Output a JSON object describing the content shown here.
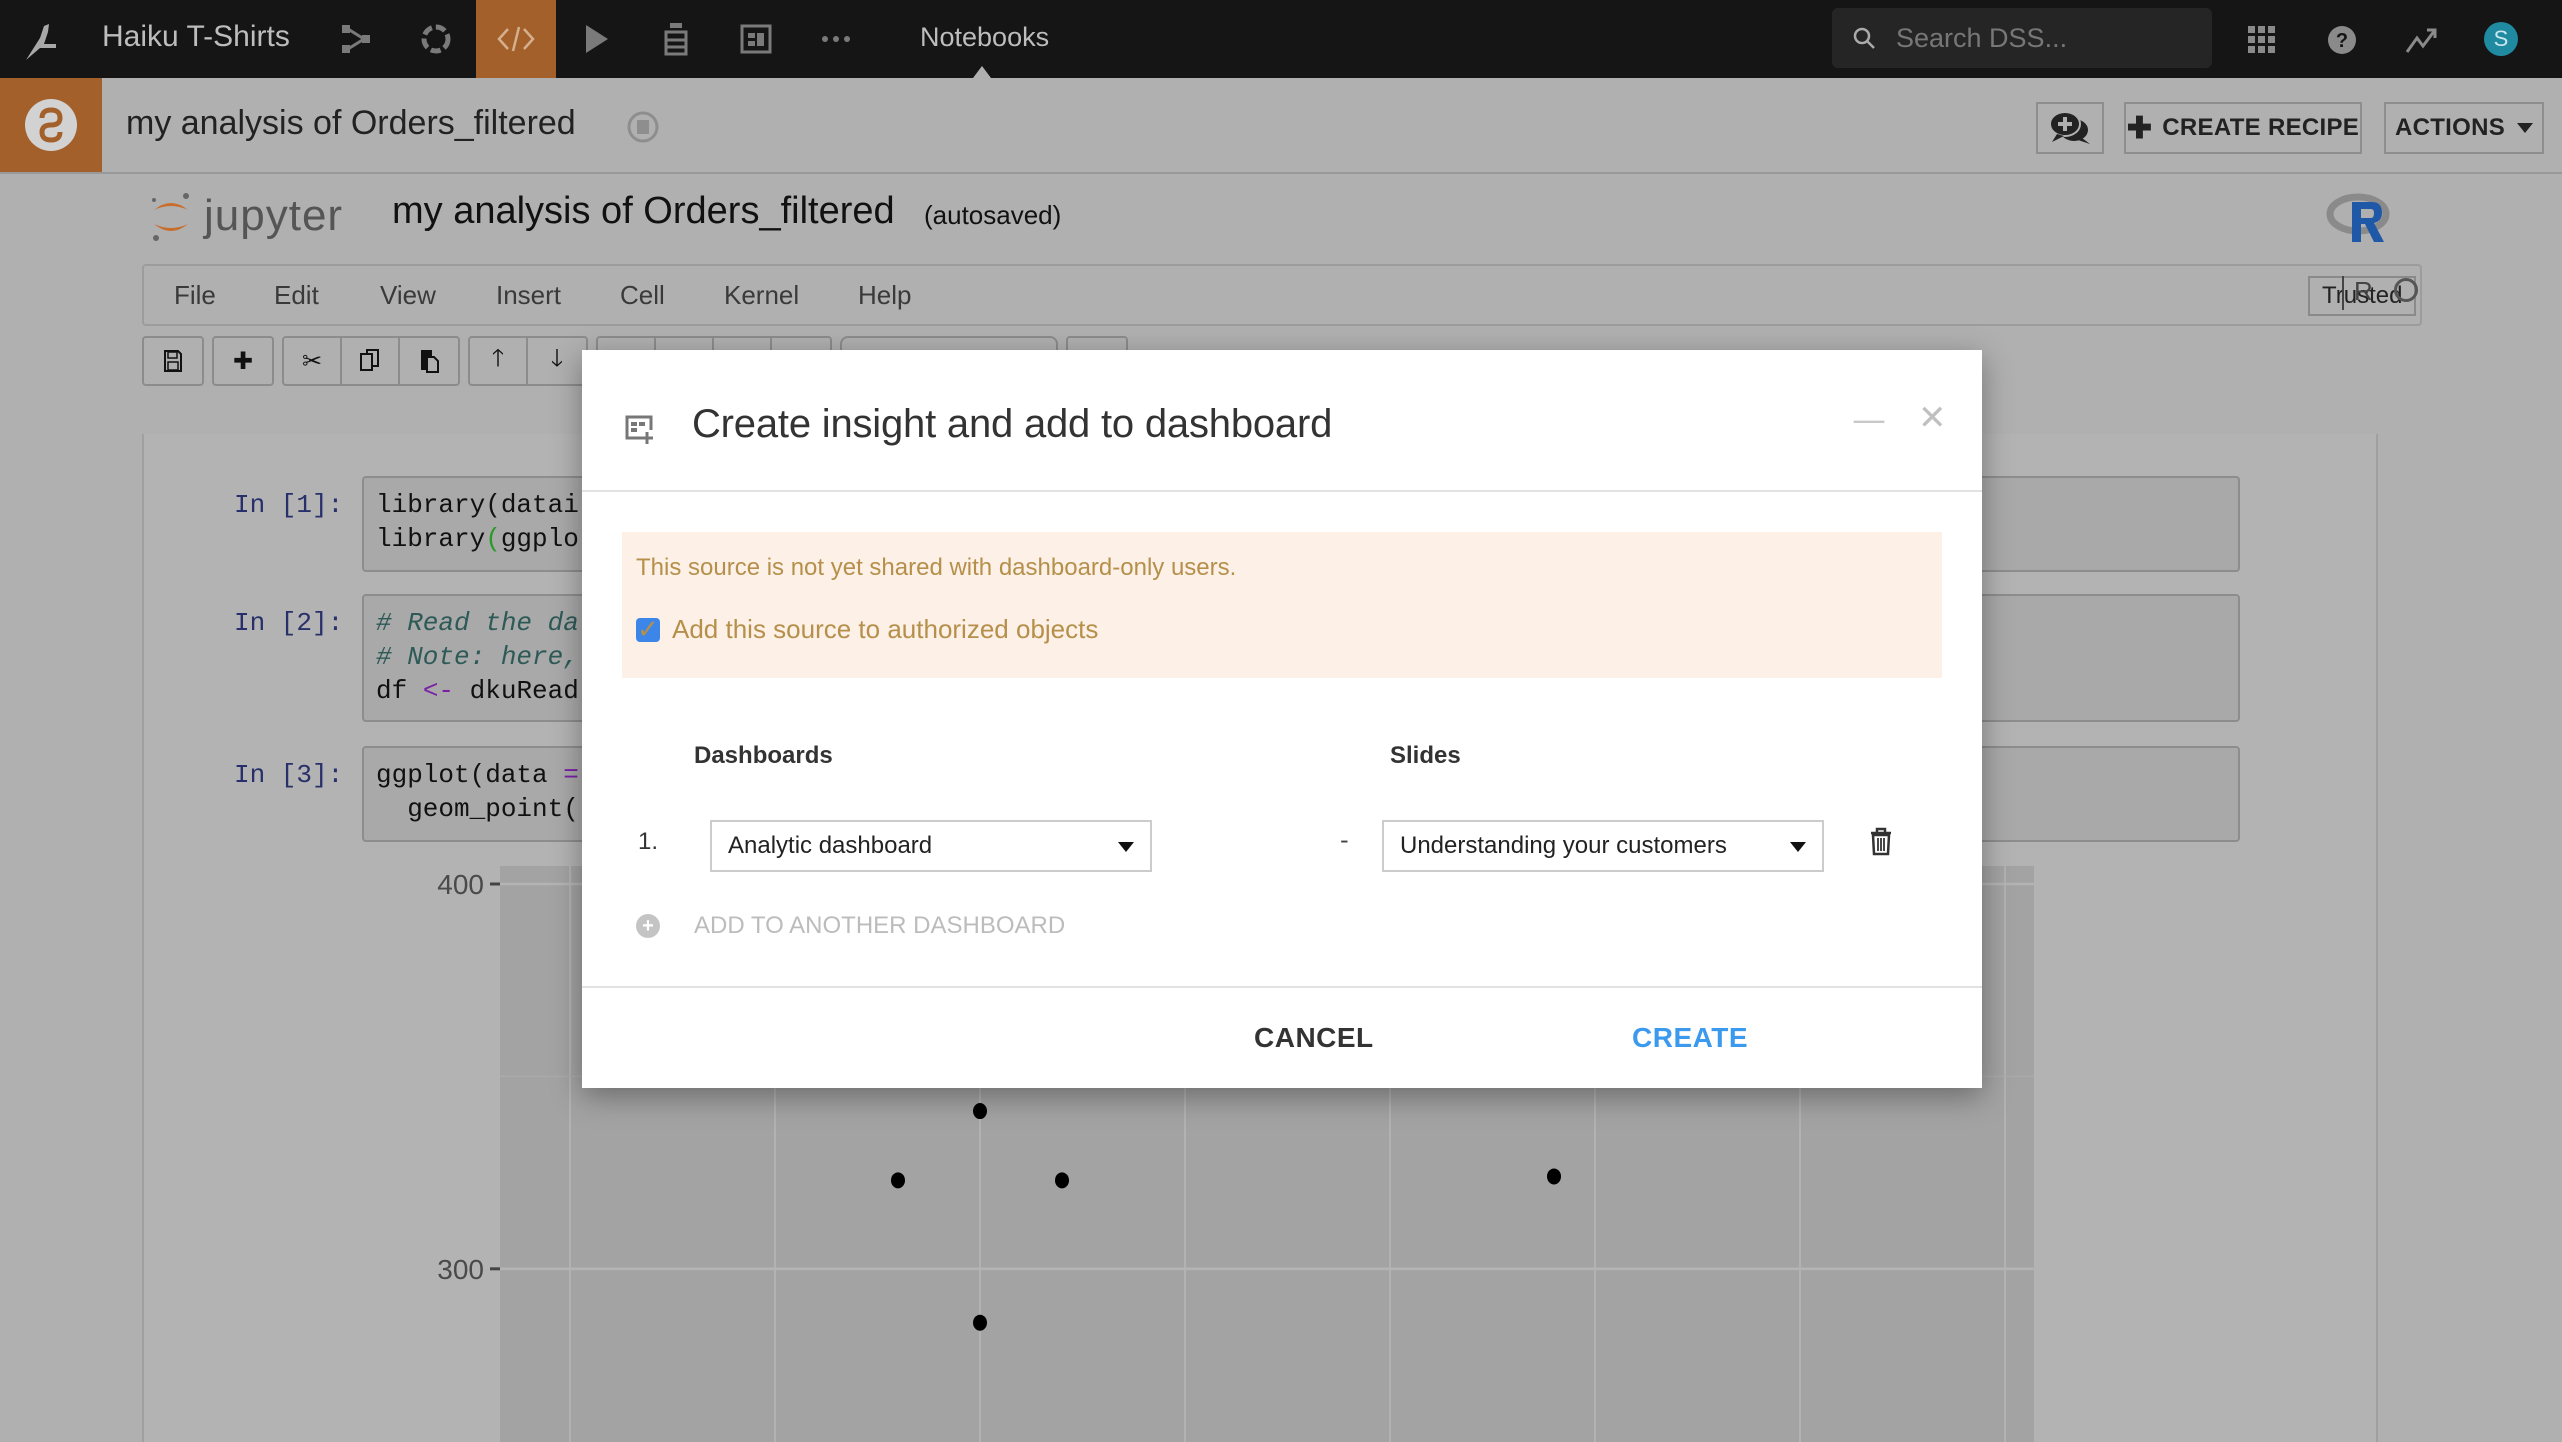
{
  "topnav": {
    "project_name": "Haiku T-Shirts",
    "icons": [
      "flow-icon",
      "lab-icon",
      "code-icon",
      "run-icon",
      "deploy-icon",
      "dashboard-icon",
      "more-icon"
    ],
    "active_icon": "code-icon",
    "section": "Notebooks",
    "search_placeholder": "Search DSS...",
    "right_icons": [
      "apps-grid-icon",
      "help-icon",
      "activity-icon"
    ],
    "avatar_initial": "S",
    "accent_color": "#a4602a"
  },
  "object_header": {
    "title": "my analysis of Orders_filtered",
    "discuss_label": "",
    "create_recipe_label": "CREATE RECIPE",
    "actions_label": "ACTIONS"
  },
  "jupyter": {
    "logo_text": "jupyter",
    "notebook_title": "my analysis of Orders_filtered",
    "save_status": "(autosaved)",
    "menu": [
      "File",
      "Edit",
      "View",
      "Insert",
      "Cell",
      "Kernel",
      "Help"
    ],
    "trusted_label": "Trusted",
    "kernel_name": "R",
    "cells": [
      {
        "prompt": "In [1]:",
        "lines": [
          [
            "library(datai"
          ],
          [
            "library",
            "(",
            "ggplo"
          ]
        ]
      },
      {
        "prompt": "In [2]:",
        "lines": [
          [
            "# Read the da"
          ],
          [
            "# Note: here,"
          ],
          [
            "df ",
            "<-",
            " dkuRead"
          ]
        ]
      },
      {
        "prompt": "In [3]:",
        "lines": [
          [
            "ggplot(data ",
            "="
          ],
          [
            "  geom_point("
          ]
        ]
      }
    ]
  },
  "chart_data": {
    "type": "scatter",
    "title": "",
    "xlabel": "",
    "ylabel": "",
    "y_ticks": [
      300,
      400
    ],
    "y_tick_labels": [
      "300",
      "400"
    ],
    "ylim_visible": [
      255,
      400
    ],
    "x_tick_count_visible": 8,
    "points": [
      {
        "x": 2.6,
        "y": 323
      },
      {
        "x": 3.0,
        "y": 341
      },
      {
        "x": 3.0,
        "y": 286
      },
      {
        "x": 3.4,
        "y": 323
      },
      {
        "x": 5.8,
        "y": 324
      }
    ],
    "grid": true
  },
  "modal": {
    "title": "Create insight and add to dashboard",
    "warning_text": "This source is not yet shared with dashboard-only users.",
    "authorize_label": "Add this source to authorized objects",
    "authorize_checked": true,
    "dashboards_header": "Dashboards",
    "slides_header": "Slides",
    "rows": [
      {
        "index": "1.",
        "dashboard": "Analytic dashboard",
        "separator": "-",
        "slide": "Understanding your customers"
      }
    ],
    "add_another_label": "ADD TO ANOTHER DASHBOARD",
    "cancel_label": "CANCEL",
    "create_label": "CREATE",
    "create_color": "#3b99ee",
    "warning_bg": "#fcf0e7",
    "warning_color": "#b6904a"
  }
}
